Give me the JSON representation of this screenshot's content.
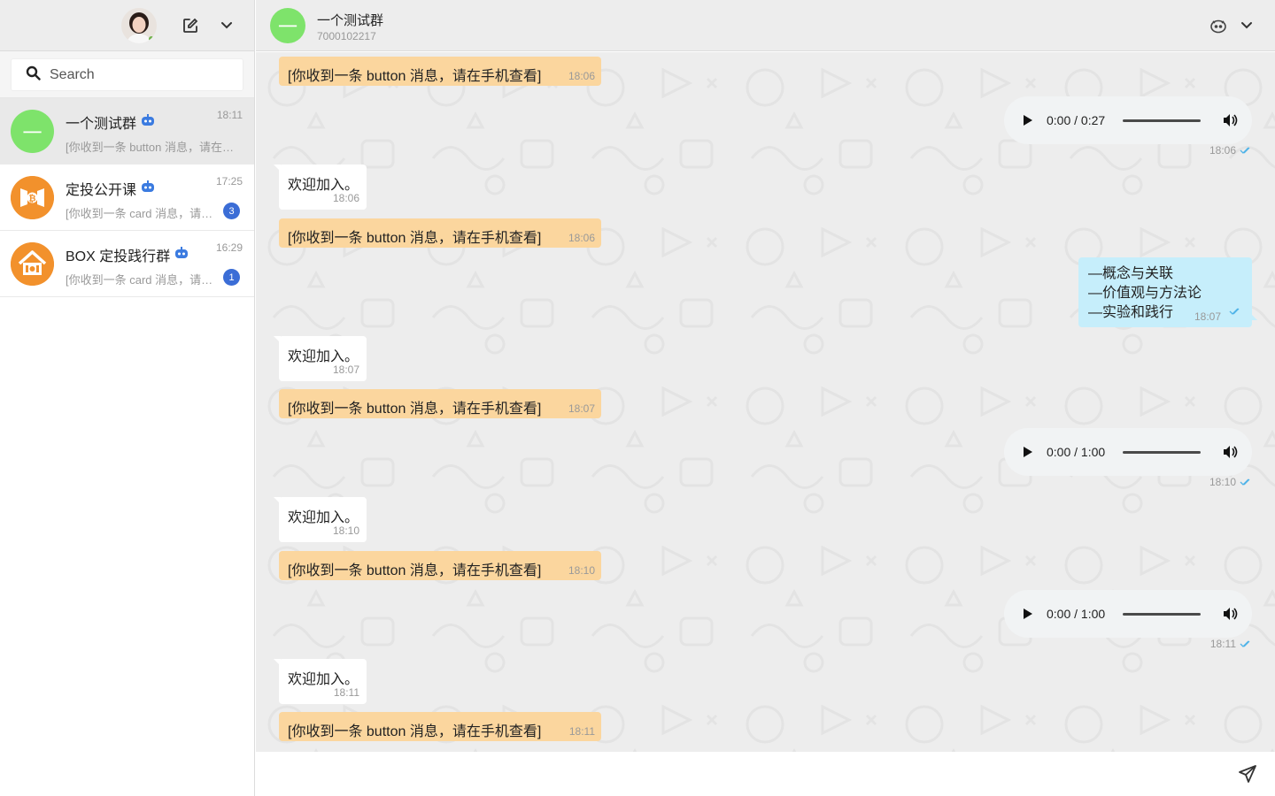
{
  "sidebar": {
    "search": {
      "placeholder": "Search"
    },
    "chats": [
      {
        "name": "一个测试群",
        "time": "18:11",
        "preview": "[你收到一条 button 消息，请在手机查看]",
        "badge": "",
        "avatar_glyph": "一"
      },
      {
        "name": "定投公开课",
        "time": "17:25",
        "preview": "[你收到一条 card 消息，请在手机查看]",
        "badge": "3"
      },
      {
        "name": "BOX 定投践行群",
        "time": "16:29",
        "preview": "[你收到一条 card 消息，请在手机查看]",
        "badge": "1"
      }
    ]
  },
  "conversation": {
    "title": "一个测试群",
    "id": "7000102217",
    "avatar_glyph": "一",
    "messages": [
      {
        "type": "system",
        "text": "[你收到一条 button 消息，请在手机查看]",
        "time": "18:06"
      },
      {
        "type": "audio",
        "current": "0:00",
        "duration": "0:27",
        "time": "18:06"
      },
      {
        "type": "incoming",
        "text": "欢迎加入。",
        "time": "18:06"
      },
      {
        "type": "system",
        "text": "[你收到一条 button 消息，请在手机查看]",
        "time": "18:06"
      },
      {
        "type": "outgoing",
        "lines": [
          "—概念与关联",
          "—价值观与方法论",
          "—实验和践行"
        ],
        "time": "18:07"
      },
      {
        "type": "incoming",
        "text": "欢迎加入。",
        "time": "18:07"
      },
      {
        "type": "system",
        "text": "[你收到一条 button 消息，请在手机查看]",
        "time": "18:07"
      },
      {
        "type": "audio",
        "current": "0:00",
        "duration": "1:00",
        "time": "18:10"
      },
      {
        "type": "incoming",
        "text": "欢迎加入。",
        "time": "18:10"
      },
      {
        "type": "system",
        "text": "[你收到一条 button 消息，请在手机查看]",
        "time": "18:10"
      },
      {
        "type": "audio",
        "current": "0:00",
        "duration": "1:00",
        "time": "18:11"
      },
      {
        "type": "incoming",
        "text": "欢迎加入。",
        "time": "18:11"
      },
      {
        "type": "system",
        "text": "[你收到一条 button 消息，请在手机查看]",
        "time": "18:11"
      }
    ]
  },
  "composer": {
    "placeholder": ""
  },
  "colors": {
    "system_bubble": "#fbd69e",
    "outgoing_bubble": "#c6eefb",
    "badge": "#3b6dd6",
    "group_avatar": "#7ee36b",
    "brand_orange": "#f2912c",
    "tick": "#4fb3e8"
  }
}
